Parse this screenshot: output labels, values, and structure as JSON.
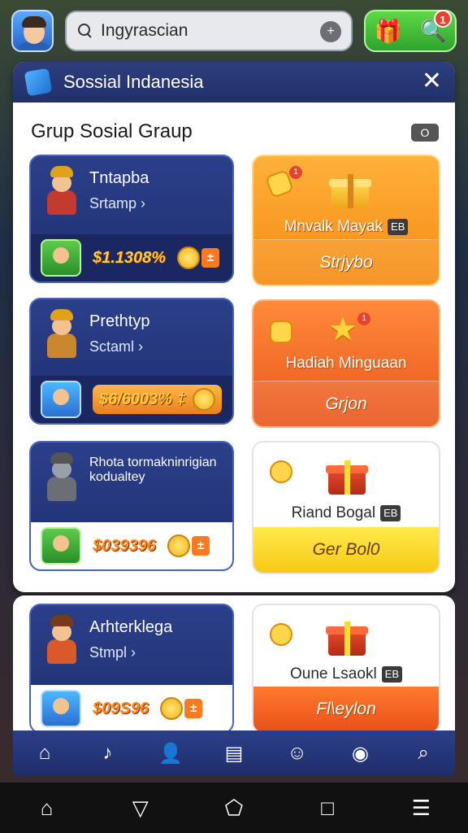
{
  "topbar": {
    "search_text": "Ingyrascian",
    "clear_glyph": "+",
    "badge": "1"
  },
  "panel": {
    "title": "Sossial Indanesia",
    "close": "✕",
    "subheading": "Grup Sosial Graup",
    "subtag": "O"
  },
  "cards_left": [
    {
      "name": "Tntapba",
      "sub": "Srtamp ›",
      "price": "$1.1308%",
      "plus": "±"
    },
    {
      "name": "Prethtyp",
      "sub": "Sctaml ›",
      "price": "$6/6003% ‡",
      "plus": ""
    },
    {
      "name": "Rhota tormakninrigian kodualtey",
      "sub": "",
      "price": "$039396",
      "plus": "±"
    },
    {
      "name": "Arhterklega",
      "sub": "Stmpl ›",
      "price": "$09S96",
      "plus": "±"
    }
  ],
  "cards_right": [
    {
      "title": "Mnvalk Mayak",
      "tag": "EB",
      "button": "Strjybo",
      "dot": "1"
    },
    {
      "title": "Hadiah Minguaan",
      "tag": "",
      "button": "Grjon",
      "dot": "1"
    },
    {
      "title": "Riand Bogal",
      "tag": "EB",
      "button": "Ger Bol0"
    },
    {
      "title": "Oune Lsaokl",
      "tag": "EB",
      "button": "Fl\\eylon"
    }
  ],
  "app_nav": [
    "home-icon",
    "music-icon",
    "user-icon",
    "bag-icon",
    "friends-icon",
    "camera-icon",
    "search-icon"
  ],
  "system_nav": [
    "home",
    "back",
    "home-circle",
    "recents",
    "menu"
  ]
}
